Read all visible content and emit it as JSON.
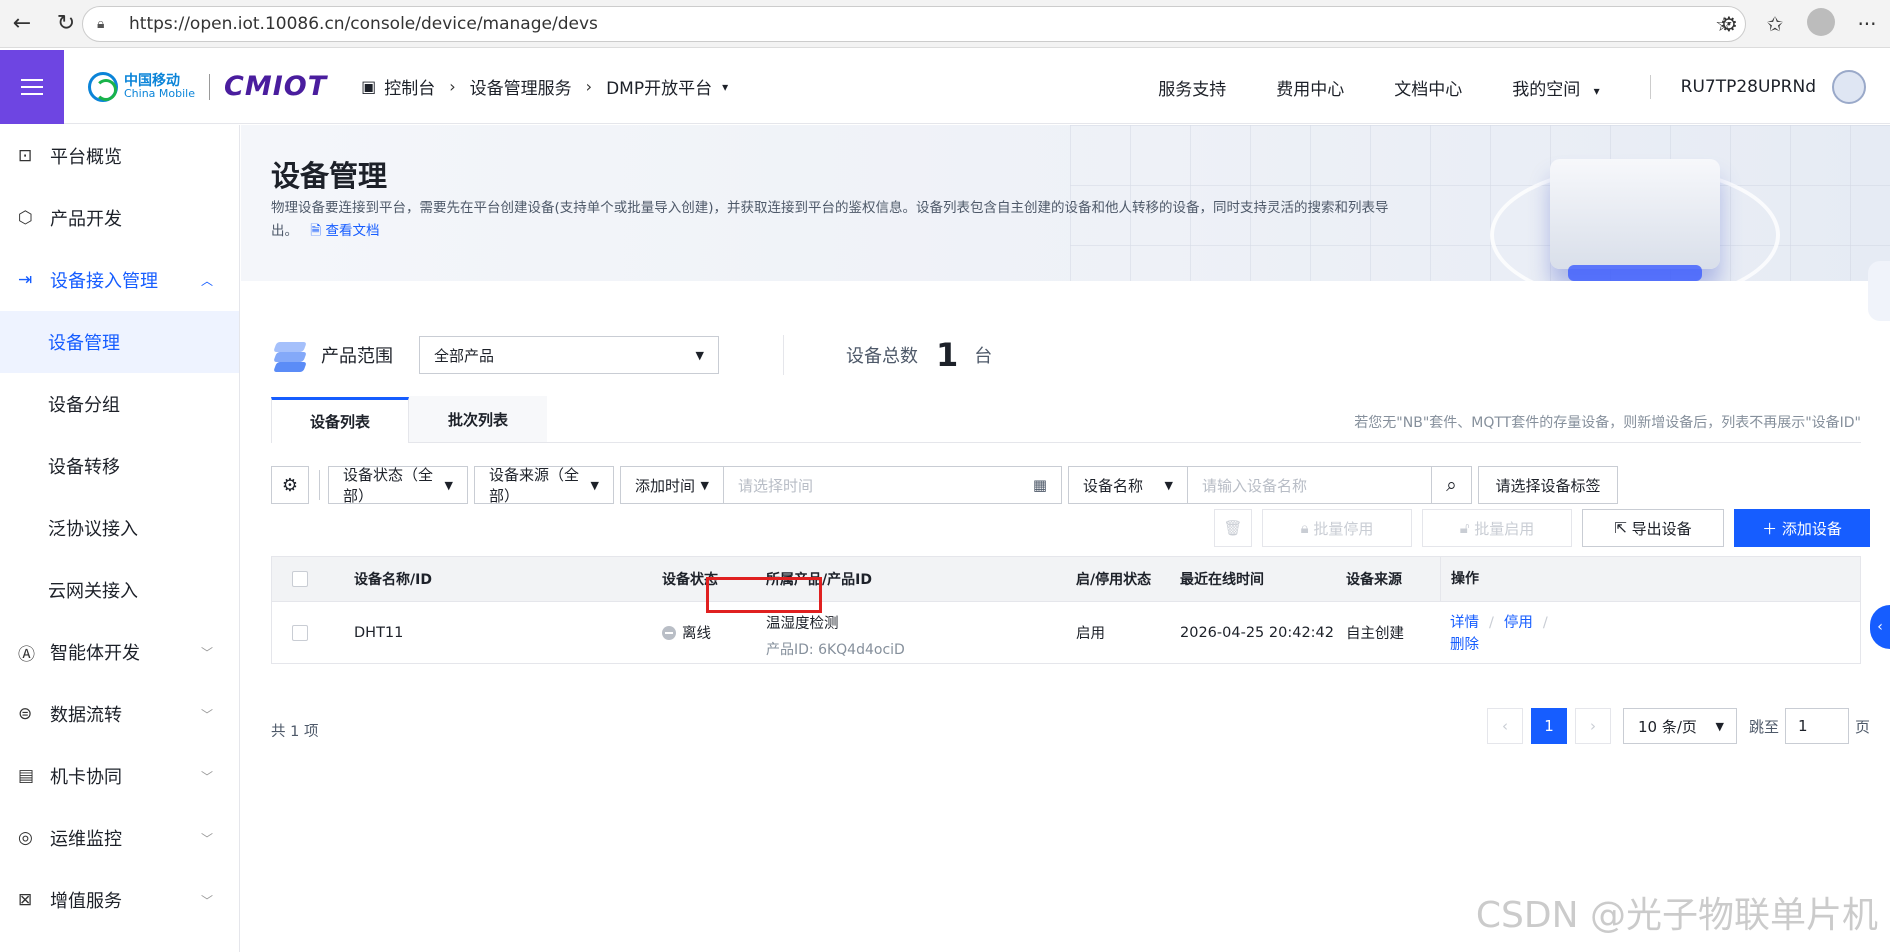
{
  "browser": {
    "url": "https://open.iot.10086.cn/console/device/manage/devs"
  },
  "header": {
    "logo_cn": "中国移动",
    "logo_en": "China Mobile",
    "logo_iot": "CMIOT",
    "breadcrumb": [
      "控制台",
      "设备管理服务",
      "DMP开放平台"
    ],
    "nav": [
      "服务支持",
      "费用中心",
      "文档中心",
      "我的空间"
    ],
    "user": "RU7TP28UPRNd"
  },
  "sidebar": {
    "items": [
      {
        "label": "平台概览",
        "icon": "chart-icon"
      },
      {
        "label": "产品开发",
        "icon": "cube-icon"
      },
      {
        "label": "设备接入管理",
        "icon": "device-access-icon",
        "open": true
      },
      {
        "label": "智能体开发",
        "icon": "ai-icon"
      },
      {
        "label": "数据流转",
        "icon": "flow-icon"
      },
      {
        "label": "机卡协同",
        "icon": "sim-card-icon"
      },
      {
        "label": "运维监控",
        "icon": "monitor-icon"
      },
      {
        "label": "增值服务",
        "icon": "value-added-icon"
      }
    ],
    "subitems": [
      "设备管理",
      "设备分组",
      "设备转移",
      "泛协议接入",
      "云网关接入"
    ]
  },
  "banner": {
    "title": "设备管理",
    "desc": "物理设备要连接到平台，需要先在平台创建设备(支持单个或批量导入创建)，并获取连接到平台的鉴权信息。设备列表包含自主创建的设备和他人转移的设备，同时支持灵活的搜索和列表导出。",
    "doc_link": "查看文档"
  },
  "product_range": {
    "label": "产品范围",
    "selected": "全部产品",
    "total_label": "设备总数",
    "total_value": "1",
    "total_unit": "台"
  },
  "tabs": {
    "items": [
      "设备列表",
      "批次列表"
    ],
    "active": 0,
    "note": "若您无\"NB\"套件、MQTT套件的存量设备，则新增设备后，列表不再展示\"设备ID\""
  },
  "filters": {
    "status": "设备状态（全部）",
    "source": "设备来源（全部）",
    "time_type": "添加时间",
    "time_placeholder": "请选择时间",
    "name_type": "设备名称",
    "name_placeholder": "请输入设备名称",
    "tag": "请选择设备标签"
  },
  "actions": {
    "batch_disable": "批量停用",
    "batch_enable": "批量启用",
    "export": "导出设备",
    "add": "添加设备"
  },
  "table": {
    "headers": [
      "设备名称/ID",
      "设备状态",
      "所属产品/产品ID",
      "启/停用状态",
      "最近在线时间",
      "设备来源",
      "操作"
    ],
    "rows": [
      {
        "name": "DHT11",
        "status": "离线",
        "product": "温湿度检测",
        "product_id": "产品ID:  6KQ4d4ociD",
        "enable_state": "启用",
        "last_online": "2026-04-25 20:42:42",
        "source": "自主创建",
        "ops": [
          "详情",
          "停用",
          "删除"
        ]
      }
    ]
  },
  "pagination": {
    "total": "共 1 项",
    "current": "1",
    "page_size": "10 条/页",
    "jump_label": "跳至",
    "jump_value": "1",
    "jump_unit": "页"
  },
  "watermark": "CSDN @光子物联单片机",
  "colors": {
    "accent": "#165dff",
    "menu_button": "#6e45e2",
    "highlight_box": "#e02020"
  }
}
